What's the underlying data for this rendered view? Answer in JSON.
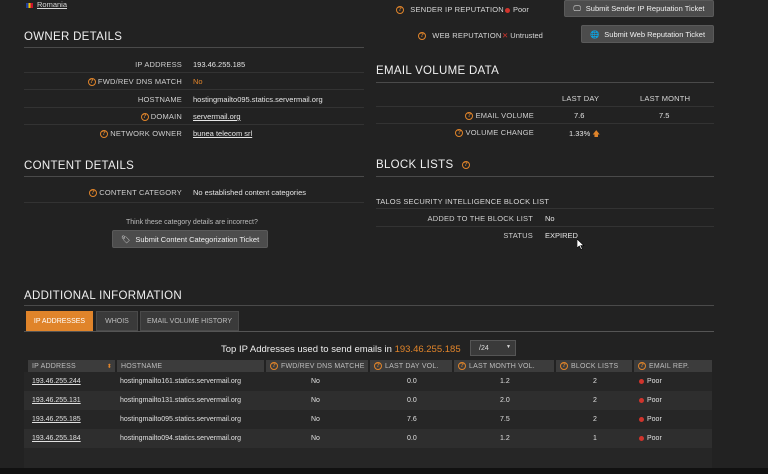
{
  "country": "Romania",
  "reputation": {
    "sender_label": "SENDER IP REPUTATION",
    "sender_value": "Poor",
    "sender_button": "Submit Sender IP Reputation Ticket",
    "web_label": "WEB REPUTATION",
    "web_value": "Untrusted",
    "web_button": "Submit Web Reputation Ticket"
  },
  "owner": {
    "title": "OWNER DETAILS",
    "rows": [
      {
        "label": "IP ADDRESS",
        "value": "193.46.255.185"
      },
      {
        "label": "FWD/REV DNS MATCH",
        "value": "No"
      },
      {
        "label": "HOSTNAME",
        "value": "hostingmailto095.statics.servermail.org"
      },
      {
        "label": "DOMAIN",
        "value": "servermail.org"
      },
      {
        "label": "NETWORK OWNER",
        "value": "bunea telecom srl"
      }
    ]
  },
  "email_volume": {
    "title": "EMAIL VOLUME DATA",
    "col_last_day": "LAST DAY",
    "col_last_month": "LAST MONTH",
    "volume_label": "EMAIL VOLUME",
    "volume_day": "7.6",
    "volume_month": "7.5",
    "change_label": "VOLUME CHANGE",
    "change_value": "1.33%"
  },
  "content": {
    "title": "CONTENT DETAILS",
    "category_label": "CONTENT CATEGORY",
    "category_value": "No established content categories",
    "incorrect_text": "Think these category details are incorrect?",
    "button": "Submit Content Categorization Ticket"
  },
  "block_lists": {
    "title": "BLOCK LISTS",
    "list_name": "TALOS SECURITY INTELLIGENCE BLOCK LIST",
    "added_label": "ADDED TO THE BLOCK LIST",
    "added_value": "No",
    "status_label": "STATUS",
    "status_value": "EXPIRED"
  },
  "additional": {
    "title": "ADDITIONAL INFORMATION",
    "tabs": [
      "IP ADDRESSES",
      "WHOIS",
      "EMAIL VOLUME HISTORY"
    ],
    "top_heading": "Top IP Addresses used to send emails in",
    "top_ip": "193.46.255.185",
    "subnet": "/24",
    "columns": [
      "IP ADDRESS",
      "HOSTNAME",
      "FWD/REV DNS MATCHE",
      "LAST DAY VOL.",
      "LAST MONTH VOL.",
      "BLOCK LISTS",
      "EMAIL REP."
    ],
    "rows": [
      {
        "ip": "193.46.255.244",
        "host": "hostingmailto161.statics.servermail.org",
        "dns": "No",
        "day": "0.0",
        "month": "1.2",
        "bl": "2",
        "rep": "Poor"
      },
      {
        "ip": "193.46.255.131",
        "host": "hostingmailto131.statics.servermail.org",
        "dns": "No",
        "day": "0.0",
        "month": "2.0",
        "bl": "2",
        "rep": "Poor"
      },
      {
        "ip": "193.46.255.185",
        "host": "hostingmailto095.statics.servermail.org",
        "dns": "No",
        "day": "7.6",
        "month": "7.5",
        "bl": "2",
        "rep": "Poor"
      },
      {
        "ip": "193.46.255.184",
        "host": "hostingmailto094.statics.servermail.org",
        "dns": "No",
        "day": "0.0",
        "month": "1.2",
        "bl": "1",
        "rep": "Poor"
      }
    ]
  },
  "colors": {
    "accent": "#e0842a",
    "bad": "#d0342c",
    "background": "#222222"
  }
}
